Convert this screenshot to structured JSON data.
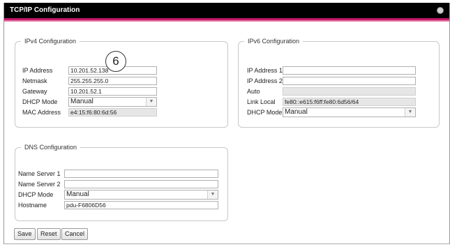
{
  "window": {
    "title": "TCP/IP Configuration"
  },
  "ipv4": {
    "legend": "IPv4 Configuration",
    "ip_address": {
      "label": "IP Address",
      "value": "10.201.52.138"
    },
    "netmask": {
      "label": "Netmask",
      "value": "255.255.255.0"
    },
    "gateway": {
      "label": "Gateway",
      "value": "10.201.52.1"
    },
    "dhcp_mode": {
      "label": "DHCP Mode",
      "value": "Manual"
    },
    "mac_address": {
      "label": "MAC Address",
      "value": "e4:15:f6:80:6d:56"
    }
  },
  "ipv6": {
    "legend": "IPv6 Configuration",
    "ip_address_1": {
      "label": "IP Address 1",
      "value": ""
    },
    "ip_address_2": {
      "label": "IP Address 2",
      "value": ""
    },
    "auto": {
      "label": "Auto",
      "value": ""
    },
    "link_local": {
      "label": "Link Local",
      "value": "fe80::e615:f6ff:fe80:6d56/64"
    },
    "dhcp_mode": {
      "label": "DHCP Mode",
      "value": "Manual"
    }
  },
  "dns": {
    "legend": "DNS Configuration",
    "name_server_1": {
      "label": "Name Server 1",
      "value": ""
    },
    "name_server_2": {
      "label": "Name Server 2",
      "value": ""
    },
    "dhcp_mode": {
      "label": "DHCP Mode",
      "value": "Manual"
    },
    "hostname": {
      "label": "Hostname",
      "value": "pdu-F6806D56"
    }
  },
  "buttons": {
    "save": "Save",
    "reset": "Reset",
    "cancel": "Cancel"
  },
  "callout": {
    "number": "6"
  },
  "colors": {
    "titlebar": "#000000",
    "accent": "#c4166a",
    "accent_light": "#e47fa6"
  }
}
